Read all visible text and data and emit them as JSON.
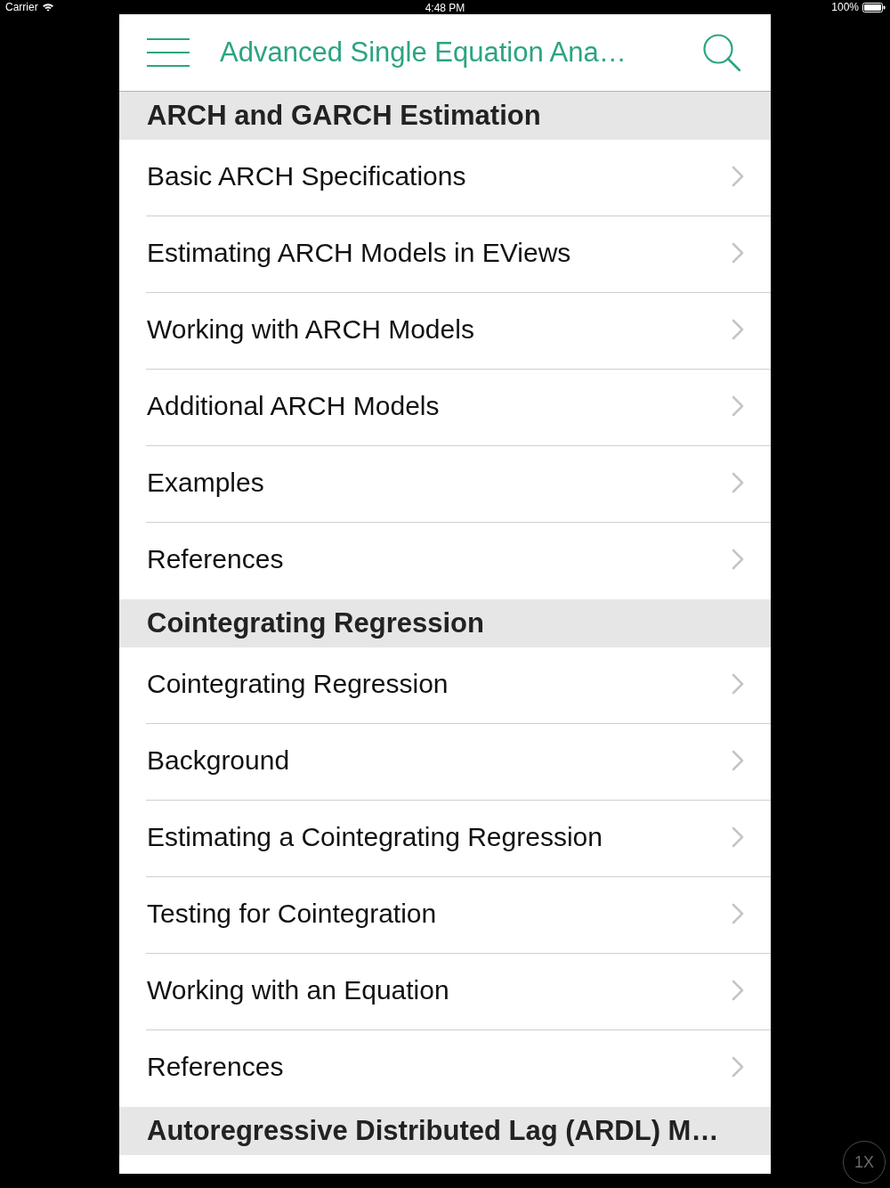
{
  "status_bar": {
    "carrier": "Carrier",
    "time": "4:48 PM",
    "battery": "100%"
  },
  "nav_bar": {
    "title": "Advanced Single Equation Ana…"
  },
  "sections": [
    {
      "title": "ARCH and GARCH Estimation",
      "items": [
        {
          "label": "Basic ARCH Specifications"
        },
        {
          "label": "Estimating ARCH Models in EViews"
        },
        {
          "label": "Working with ARCH Models"
        },
        {
          "label": "Additional ARCH Models"
        },
        {
          "label": "Examples"
        },
        {
          "label": "References"
        }
      ]
    },
    {
      "title": "Cointegrating Regression",
      "items": [
        {
          "label": "Cointegrating Regression"
        },
        {
          "label": "Background"
        },
        {
          "label": "Estimating a Cointegrating Regression"
        },
        {
          "label": "Testing for Cointegration"
        },
        {
          "label": "Working with an Equation"
        },
        {
          "label": "References"
        }
      ]
    },
    {
      "title": "Autoregressive Distributed Lag (ARDL) M…"
    }
  ],
  "zoom_button": {
    "label": "1X"
  }
}
